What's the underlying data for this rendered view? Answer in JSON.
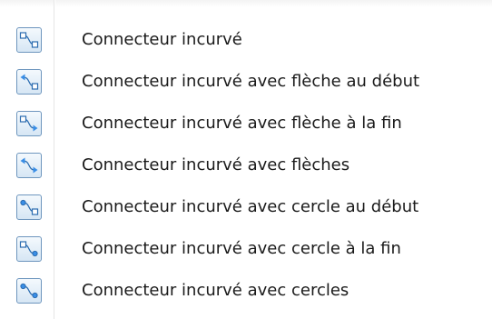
{
  "menu": {
    "items": [
      {
        "label": "Connecteur incurvé",
        "icon": "curved-connector-icon",
        "start": "square",
        "end": "square"
      },
      {
        "label": "Connecteur incurvé avec flèche au début",
        "icon": "curved-connector-arrow-start-icon",
        "start": "arrow",
        "end": "square"
      },
      {
        "label": "Connecteur incurvé avec flèche à la fin",
        "icon": "curved-connector-arrow-end-icon",
        "start": "square",
        "end": "arrow"
      },
      {
        "label": "Connecteur incurvé avec flèches",
        "icon": "curved-connector-arrows-icon",
        "start": "arrow",
        "end": "arrow"
      },
      {
        "label": "Connecteur incurvé avec cercle au début",
        "icon": "curved-connector-circle-start-icon",
        "start": "circle",
        "end": "square"
      },
      {
        "label": "Connecteur incurvé avec cercle à la fin",
        "icon": "curved-connector-circle-end-icon",
        "start": "square",
        "end": "circle"
      },
      {
        "label": "Connecteur incurvé avec cercles",
        "icon": "curved-connector-circles-icon",
        "start": "circle",
        "end": "circle"
      }
    ]
  },
  "colors": {
    "icon_stroke": "#2b6cb0",
    "icon_fill": "#3a8ee6",
    "icon_border": "#6e96be",
    "text": "#1a1a1a"
  }
}
